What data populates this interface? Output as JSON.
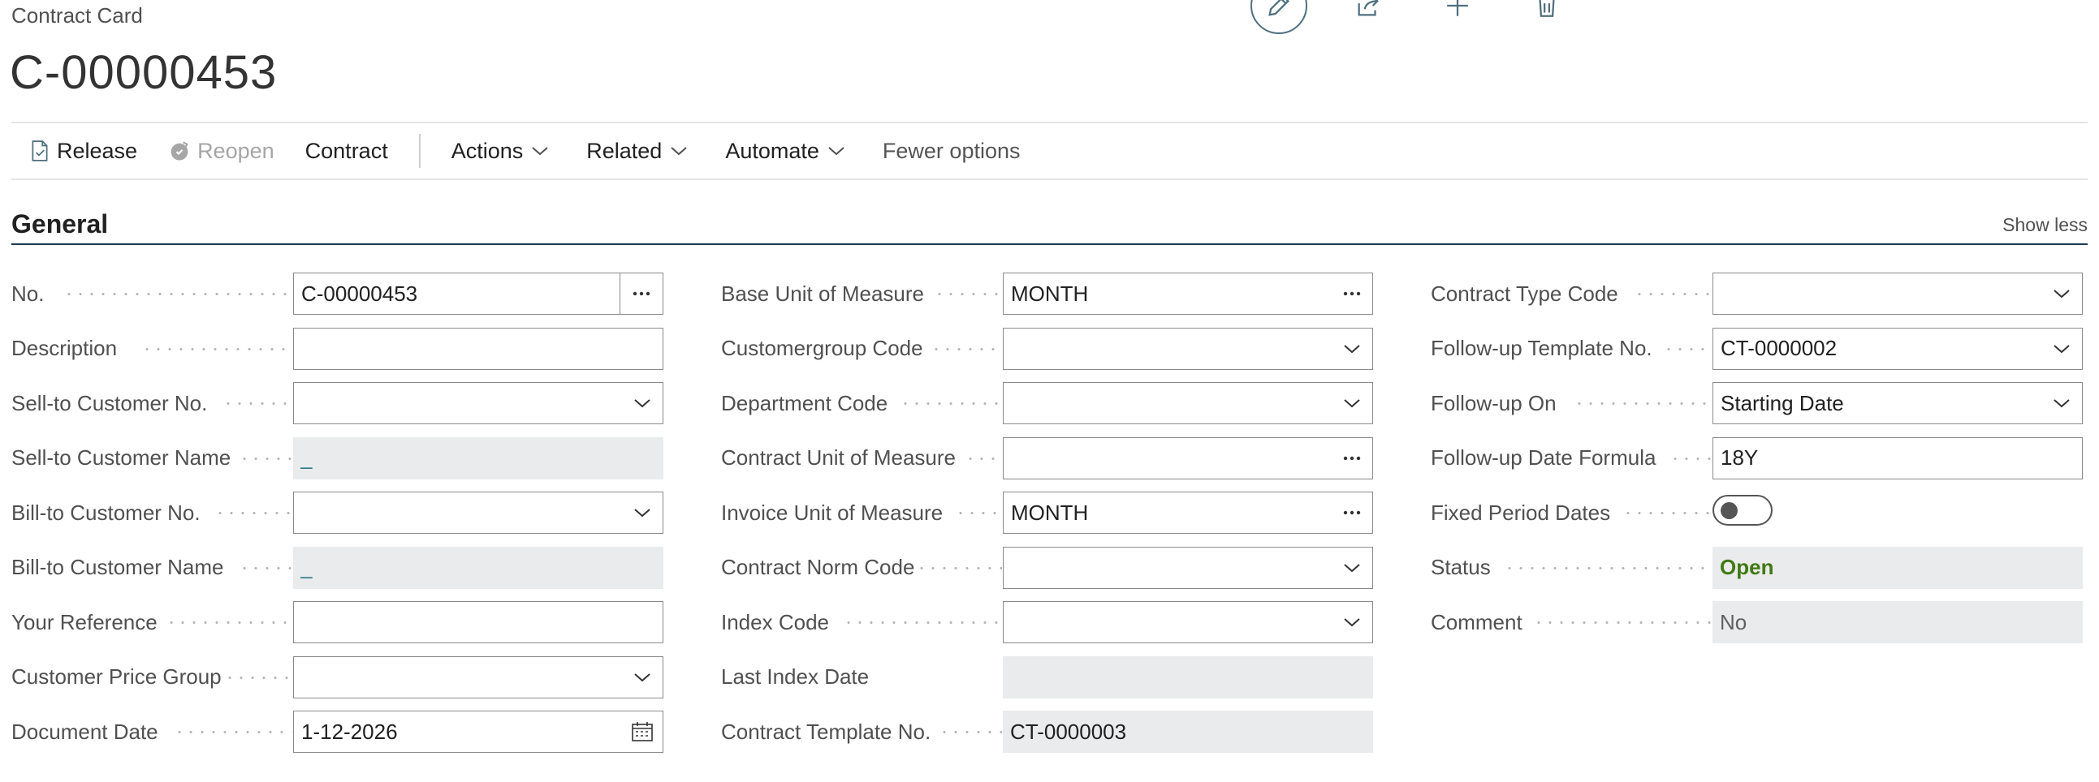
{
  "header": {
    "caption": "Contract Card",
    "title": "C-00000453"
  },
  "top_actions": [
    {
      "icon": "edit-icon"
    },
    {
      "icon": "share-icon"
    },
    {
      "icon": "add-icon"
    },
    {
      "icon": "delete-icon"
    }
  ],
  "commands": {
    "release": "Release",
    "reopen": "Reopen",
    "contract": "Contract",
    "actions": "Actions",
    "related": "Related",
    "automate": "Automate",
    "fewer_options": "Fewer options"
  },
  "section": {
    "title": "General",
    "toggle": "Show less"
  },
  "col1": {
    "no": {
      "label": "No.",
      "value": "C-00000453"
    },
    "description": {
      "label": "Description",
      "value": ""
    },
    "sell_to_no": {
      "label": "Sell-to Customer No.",
      "value": ""
    },
    "sell_to_name": {
      "label": "Sell-to Customer Name",
      "value": "_"
    },
    "bill_to_no": {
      "label": "Bill-to Customer No.",
      "value": ""
    },
    "bill_to_name": {
      "label": "Bill-to Customer Name",
      "value": "_"
    },
    "your_reference": {
      "label": "Your Reference",
      "value": ""
    },
    "price_group": {
      "label": "Customer Price Group",
      "value": ""
    },
    "document_date": {
      "label": "Document Date",
      "value": "1-12-2026"
    }
  },
  "col2": {
    "base_uom": {
      "label": "Base Unit of Measure",
      "value": "MONTH"
    },
    "custgroup": {
      "label": "Customergroup Code",
      "value": ""
    },
    "department": {
      "label": "Department Code",
      "value": ""
    },
    "contract_uom": {
      "label": "Contract Unit of Measure",
      "value": ""
    },
    "invoice_uom": {
      "label": "Invoice Unit of Measure",
      "value": "MONTH"
    },
    "norm_code": {
      "label": "Contract Norm Code",
      "value": ""
    },
    "index_code": {
      "label": "Index Code",
      "value": ""
    },
    "last_index_date": {
      "label": "Last Index Date",
      "value": ""
    },
    "template_no": {
      "label": "Contract Template No.",
      "value": "CT-0000003"
    }
  },
  "col3": {
    "type_code": {
      "label": "Contract Type Code",
      "value": ""
    },
    "followup_template": {
      "label": "Follow-up Template No.",
      "value": "CT-0000002"
    },
    "followup_on": {
      "label": "Follow-up On",
      "value": "Starting Date"
    },
    "followup_formula": {
      "label": "Follow-up Date Formula",
      "value": "18Y"
    },
    "fixed_period": {
      "label": "Fixed Period Dates",
      "value": false
    },
    "status": {
      "label": "Status",
      "value": "Open"
    },
    "comment": {
      "label": "Comment",
      "value": "No"
    }
  },
  "colors": {
    "accent": "#1c3a54",
    "status_open": "#3f7a13",
    "readonly_bg": "#eaebec"
  }
}
